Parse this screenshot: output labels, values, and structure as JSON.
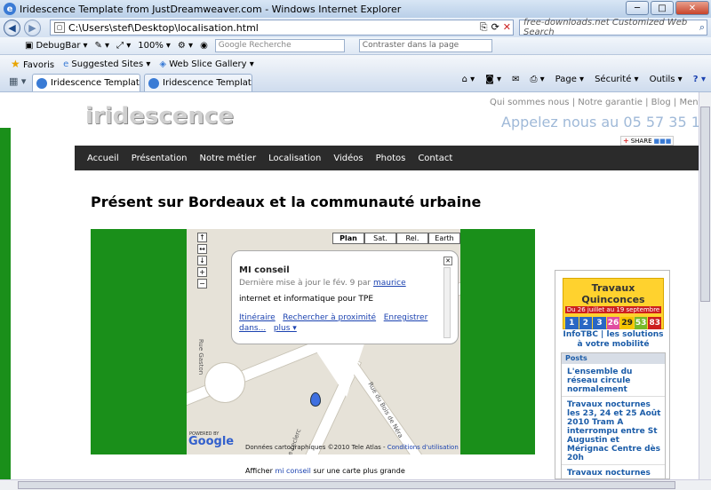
{
  "window": {
    "title": "Iridescence Template from JustDreamweaver.com - Windows Internet Explorer",
    "min": "─",
    "max": "□",
    "close": "✕"
  },
  "nav": {
    "back": "◀",
    "forward": "▶",
    "url": "C:\\Users\\stef\\Desktop\\localisation.html",
    "search_placeholder": "free-downloads.net Customized Web Search"
  },
  "toolbar": {
    "debugbar": "DebugBar",
    "zoom": "100%",
    "google_search": "Google Recherche",
    "contrast": "Contraster dans la page"
  },
  "favorites": {
    "favoris": "Favoris",
    "suggested": "Suggested Sites ▾",
    "webslice": "Web Slice Gallery ▾"
  },
  "tabs": [
    {
      "label": "Iridescence Template fr..."
    },
    {
      "label": "Iridescence Template from..."
    }
  ],
  "commands": {
    "page": "Page ▾",
    "securite": "Sécurité ▾",
    "outils": "Outils ▾",
    "help": "? ▾"
  },
  "site": {
    "logo": "iridescence",
    "top_links": "Qui sommes nous | Notre garantie | Blog | Mentions légales",
    "phone": "Appelez nous au 05 57 35 10 55",
    "share": "SHARE",
    "menu": [
      "Accueil",
      "Présentation",
      "Notre métier",
      "Localisation",
      "Vidéos",
      "Photos",
      "Contact"
    ],
    "title": "Présent sur Bordeaux et la communauté urbaine"
  },
  "map": {
    "types": [
      "Plan",
      "Sat.",
      "Rel.",
      "Earth"
    ],
    "bubble": {
      "name": "MI conseil",
      "updated": "Dernière mise à jour le fév. 9 par",
      "author": "maurice",
      "desc": "internet et informatique pour TPE",
      "link1": "Itinéraire",
      "link2": "Rechercher à proximité",
      "link3": "Enregistrer dans...",
      "more": "plus ▾"
    },
    "street1": "Rue du Bois de Néra",
    "street2": "Rue Gaston",
    "street3": "ave Leclerc",
    "powered": "POWERED BY",
    "google": "Google",
    "footer": "Données cartographiques ©2010 Tele Atlas -",
    "terms": "Conditions d'utilisation"
  },
  "afficher": {
    "pre": "Afficher",
    "link": "mi conseil",
    "post": "sur une carte plus grande"
  },
  "sidebar": {
    "ad_title": "Travaux Quinconces",
    "ad_dates": "Du 26 juillet au 19 septembre",
    "ad_boxes": [
      "1",
      "2",
      "3",
      "26",
      "29",
      "53",
      "83"
    ],
    "infotbc": "InfoTBC | les solutions à votre mobilité",
    "posts_header": "Posts",
    "posts": [
      "L'ensemble du réseau circule normalement",
      "Travaux nocturnes les 23, 24 et 25 Août 2010 Tram A interrompu entre St Augustin et Mérignac Centre dès 20h",
      "Travaux nocturnes"
    ]
  },
  "colors": {
    "green": "#1a8f1a",
    "menu_bg": "#2b2b2b",
    "link": "#1b42b0",
    "phone": "#9fb9d8"
  }
}
